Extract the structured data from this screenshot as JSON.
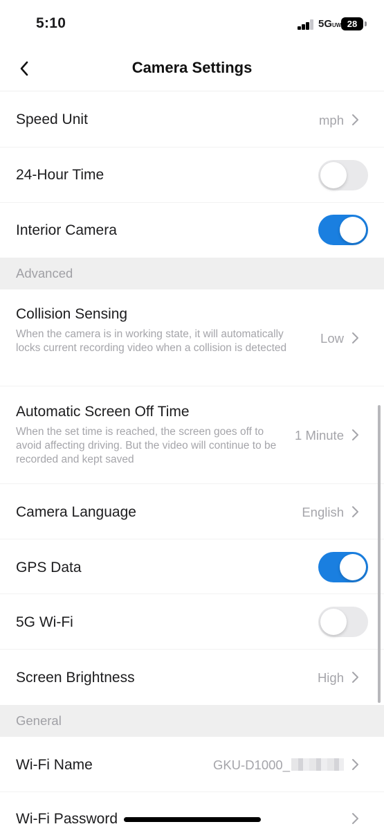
{
  "status_bar": {
    "time": "5:10",
    "network": "5G",
    "network_sub": "UW",
    "battery": "28",
    "icons": [
      "signal-icon",
      "battery-icon"
    ]
  },
  "nav": {
    "title": "Camera Settings",
    "back_icon": "chevron-left-icon"
  },
  "rows": {
    "speed_unit": {
      "title": "Speed Unit",
      "value": "mph"
    },
    "hour_time": {
      "title": "24-Hour Time",
      "toggle": false
    },
    "interior_camera": {
      "title": "Interior Camera",
      "toggle": true
    }
  },
  "sections": {
    "advanced": "Advanced",
    "general": "General"
  },
  "advanced": {
    "collision": {
      "title": "Collision Sensing",
      "desc": "When the camera is in working state, it will automatically locks current recording video when a collision is detected",
      "value": "Low"
    },
    "screen_off": {
      "title": "Automatic Screen Off Time",
      "desc": "When the set time is reached, the screen goes off to avoid affecting driving. But the video will continue to be recorded and kept saved",
      "value": "1 Minute"
    },
    "language": {
      "title": "Camera Language",
      "value": "English"
    },
    "gps": {
      "title": "GPS Data",
      "toggle": true
    },
    "wifi_5g": {
      "title": "5G Wi-Fi",
      "toggle": false
    },
    "brightness": {
      "title": "Screen Brightness",
      "value": "High"
    }
  },
  "general": {
    "wifi_name": {
      "title": "Wi-Fi Name",
      "value": "GKU-D1000_"
    },
    "wifi_password": {
      "title": "Wi-Fi Password"
    }
  },
  "colors": {
    "accent": "#1a7fe0",
    "toggle_off": "#e9e9eb",
    "secondary_text": "#a5a5aa",
    "section_bg": "#efefef"
  }
}
